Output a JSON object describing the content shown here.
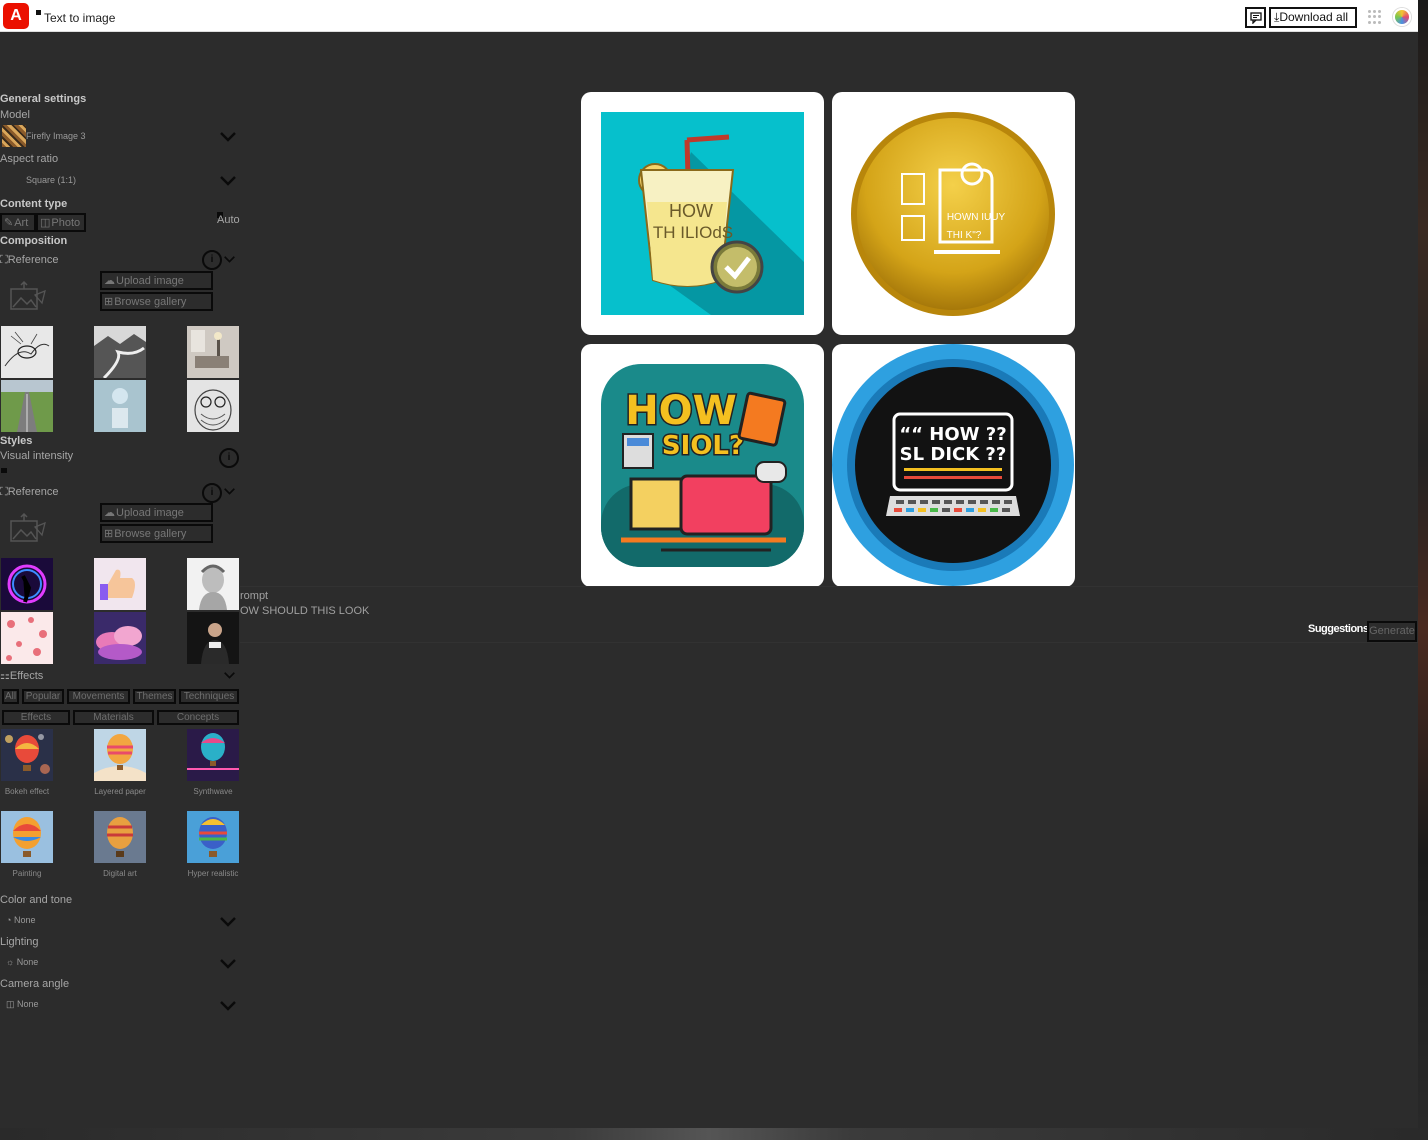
{
  "topbar": {
    "app_name": "Text to image",
    "logo_letter": "A",
    "download_all": "Download all"
  },
  "sidebar": {
    "general_settings": "General settings",
    "model_label": "Model",
    "model_value": "Firefly Image 3",
    "aspect_label": "Aspect ratio",
    "aspect_value": "Square (1:1)",
    "content_type_label": "Content type",
    "content_type_options": [
      "Art",
      "Photo"
    ],
    "content_type_auto": "Auto",
    "composition_label": "Composition",
    "reference_label": "Reference",
    "upload_image": "Upload image",
    "browse_gallery": "Browse gallery",
    "styles_label": "Styles",
    "visual_intensity_label": "Visual intensity",
    "effects_label": "Effects",
    "effect_tabs_row1": [
      "All",
      "Popular",
      "Movements",
      "Themes",
      "Techniques"
    ],
    "effect_tabs_row2": [
      "Effects",
      "Materials",
      "Concepts"
    ],
    "effect_items": [
      "Bokeh effect",
      "Layered paper",
      "Synthwave",
      "Painting",
      "Digital art",
      "Hyper realistic"
    ],
    "color_tone_label": "Color and tone",
    "color_tone_value": "None",
    "lighting_label": "Lighting",
    "lighting_value": "None",
    "camera_label": "Camera angle",
    "camera_value": "None"
  },
  "gallery": {
    "images": [
      {
        "text_lines": [
          "HOW",
          "TH ILIOdS"
        ]
      },
      {
        "text_lines": [
          "HOWN IUUY",
          "THI K\"?"
        ]
      },
      {
        "text_lines": [
          "HOW",
          "SIOL?"
        ]
      },
      {
        "text_lines": [
          "““ HOW ??",
          "SL DICK ??"
        ]
      }
    ]
  },
  "prompt": {
    "label": "rompt",
    "value": "OW SHOULD THIS LOOK",
    "suggestions": "Suggestions",
    "generate": "Generate"
  },
  "colors": {
    "brand_red": "#eb1000",
    "background": "#2c2c2c",
    "topbar": "#ffffff"
  }
}
